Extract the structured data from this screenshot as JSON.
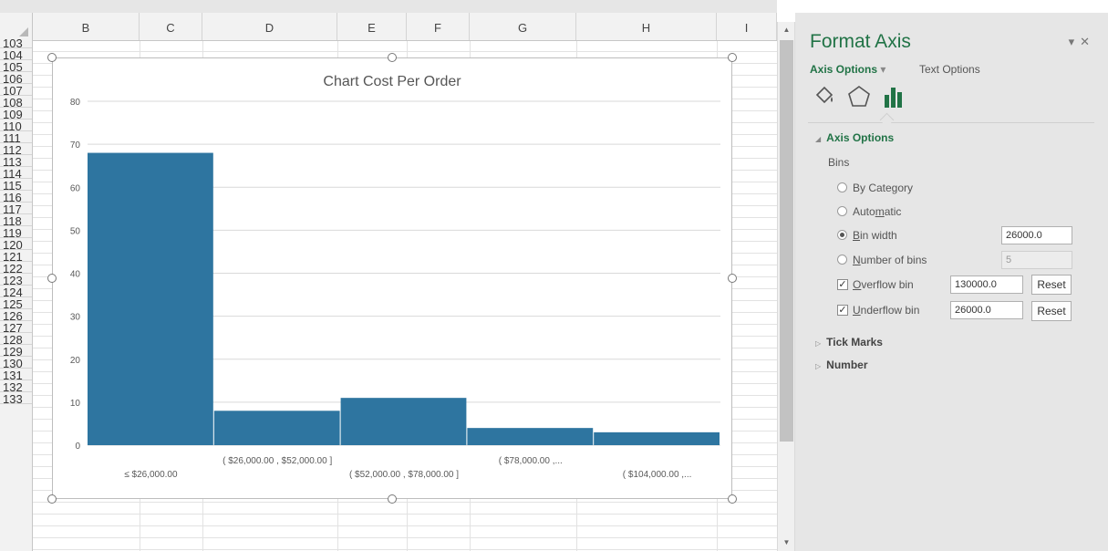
{
  "spreadsheet": {
    "columns": [
      "B",
      "C",
      "D",
      "E",
      "F",
      "G",
      "H",
      "I"
    ],
    "rows": [
      "103",
      "104",
      "105",
      "106",
      "107",
      "108",
      "109",
      "110",
      "111",
      "112",
      "113",
      "114",
      "115",
      "116",
      "117",
      "118",
      "119",
      "120",
      "121",
      "122",
      "123",
      "124",
      "125",
      "126",
      "127",
      "128",
      "129",
      "130",
      "131",
      "132",
      "133"
    ]
  },
  "chart_data": {
    "type": "bar",
    "title": "Chart Cost Per Order",
    "categories": [
      "≤ $26,000.00",
      "( $26,000.00 , $52,000.00 ]",
      "( $52,000.00 , $78,000.00 ]",
      "( $78,000.00 ,...",
      "( $104,000.00 ,..."
    ],
    "values": [
      68,
      8,
      11,
      4,
      3
    ],
    "ylim": [
      0,
      80
    ],
    "yticks": [
      "0",
      "10",
      "20",
      "30",
      "40",
      "50",
      "60",
      "70",
      "80"
    ],
    "grid": true,
    "bar_color": "#2e75a0"
  },
  "panel": {
    "title": "Format Axis",
    "tab_axis_options": "Axis Options",
    "tab_text_options": "Text Options",
    "section_axis_options": "Axis Options",
    "bins_label": "Bins",
    "by_category": "By Category",
    "automatic_pre": "Auto",
    "automatic_u": "m",
    "automatic_post": "atic",
    "bin_width_u": "B",
    "bin_width_post": "in width",
    "bin_width_value": "26000.0",
    "num_bins_u": "N",
    "num_bins_post": "umber of bins",
    "num_bins_value": "5",
    "overflow_u": "O",
    "overflow_post": "verflow bin",
    "overflow_value": "130000.0",
    "underflow_u": "U",
    "underflow_post": "nderflow bin",
    "underflow_value": "26000.0",
    "reset_label": "Reset",
    "tick_marks": "Tick Marks",
    "number": "Number",
    "accent_color": "#217346"
  }
}
